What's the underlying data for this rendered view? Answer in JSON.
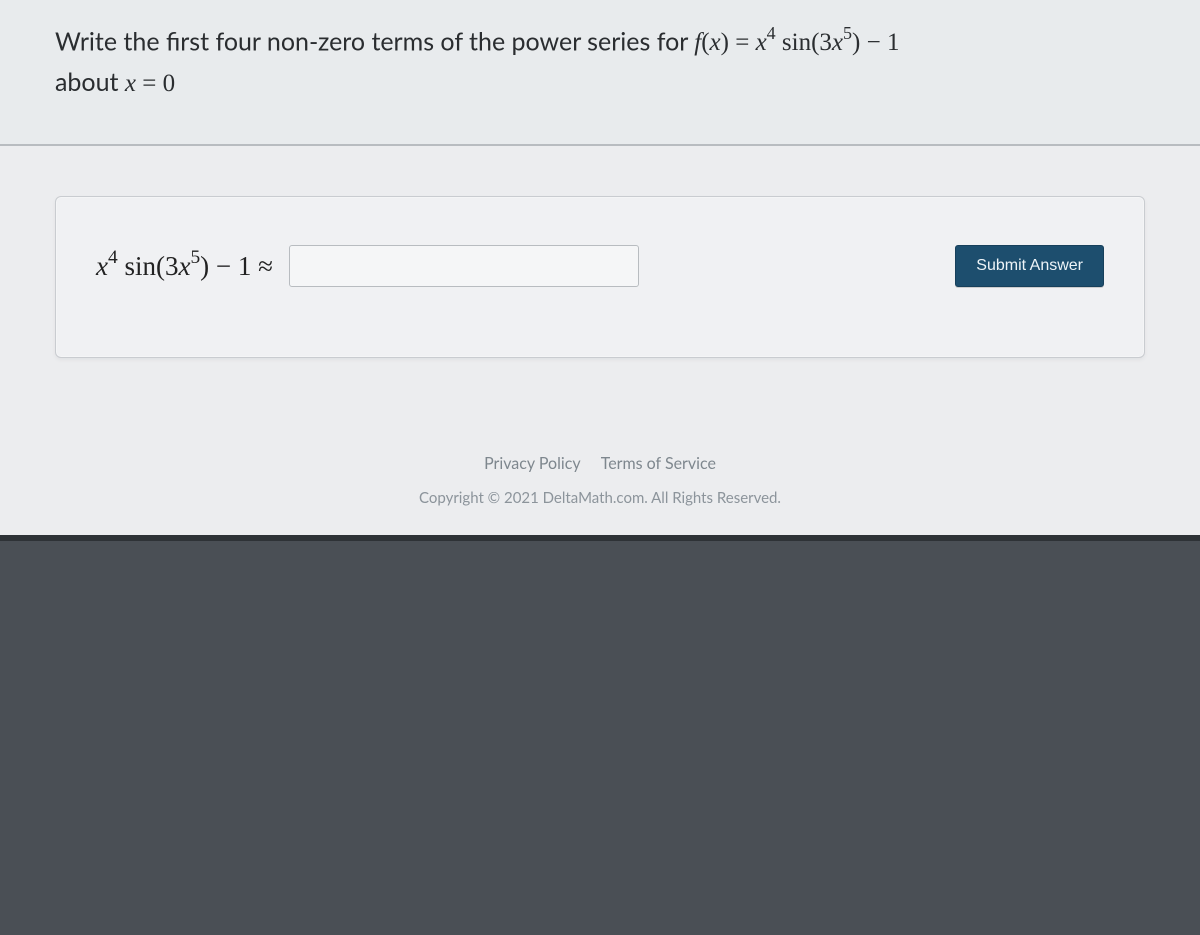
{
  "question": {
    "prefix": "Write the first four non-zero terms of the power series for ",
    "func_lhs_html": "<span class='math'>f</span><span class='rm'>(</span><span class='math'>x</span><span class='rm'>)</span> <span class='rm'>=</span> <span class='math'>x</span><sup class='rm'>4</sup>&nbsp;<span class='rm'>sin(3</span><span class='math'>x</span><sup class='rm'>5</sup><span class='rm'>)</span> <span class='rm'>− 1</span>",
    "suffix": " about ",
    "about_html": "<span class='math'>x</span> <span class='rm'>= 0</span>"
  },
  "answer": {
    "lhs_html": "<span class='math'>x</span><sup class='rm'>4</sup>&nbsp;<span class='rm'>sin(3</span><span class='math'>x</span><sup class='rm'>5</sup><span class='rm'>)</span> <span class='rm'>− 1 ≈</span>",
    "input_value": "",
    "input_placeholder": ""
  },
  "buttons": {
    "submit": "Submit Answer"
  },
  "footer": {
    "privacy": "Privacy Policy",
    "terms": "Terms of Service",
    "copyright": "Copyright © 2021 DeltaMath.com. All Rights Reserved."
  }
}
